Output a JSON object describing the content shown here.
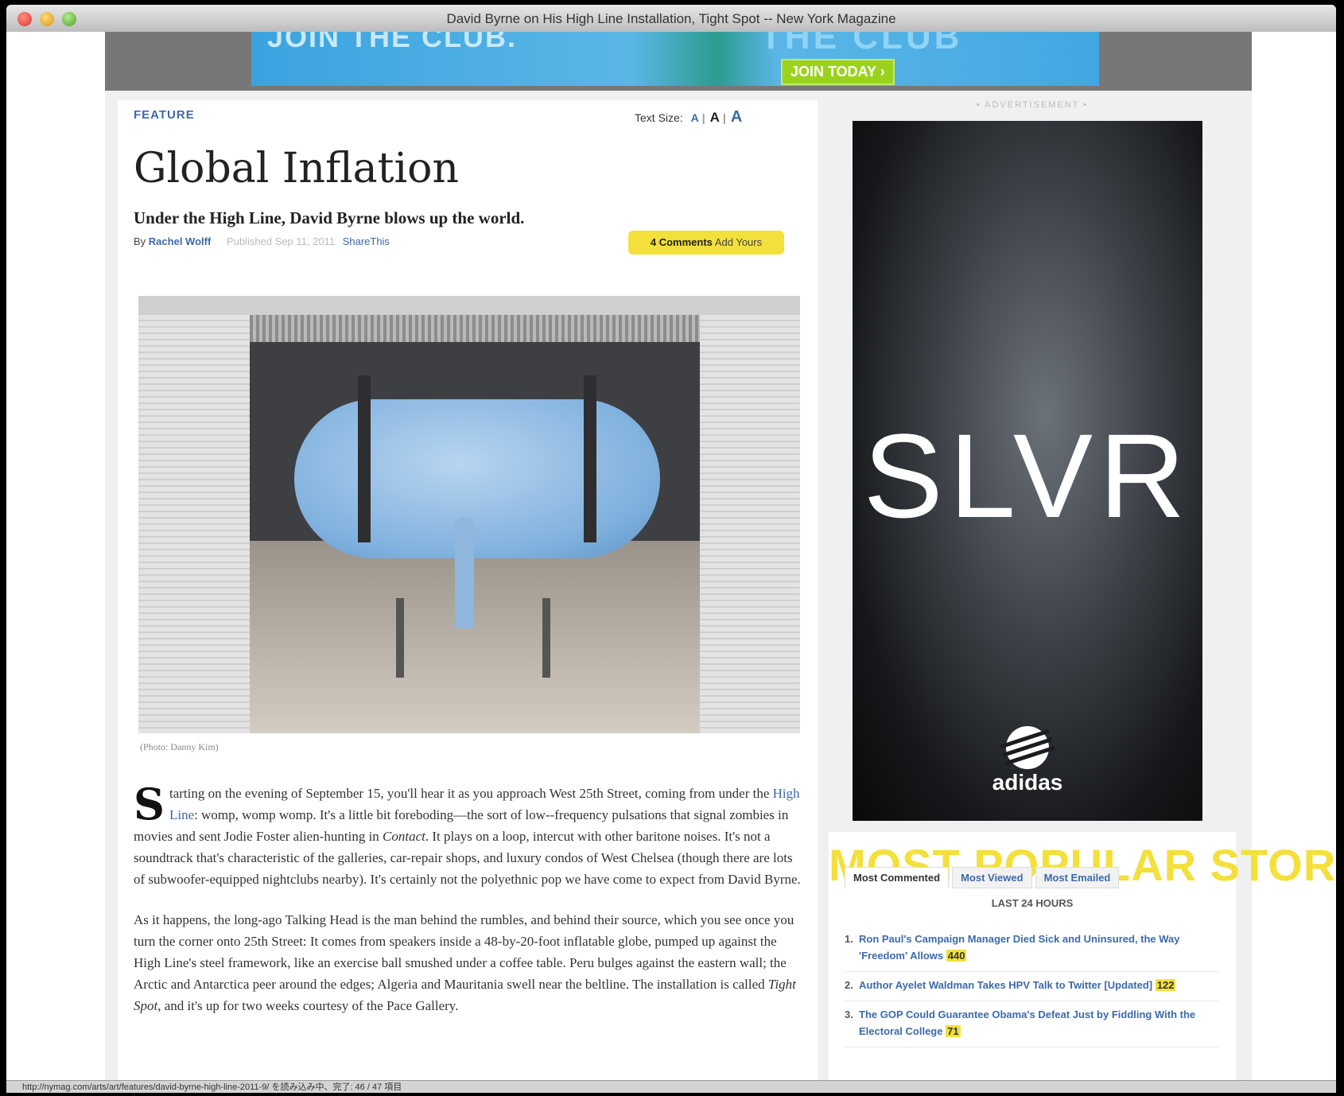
{
  "window": {
    "title": "David Byrne on His High Line Installation, Tight Spot -- New York Magazine"
  },
  "banner": {
    "left_text": "JOIN THE CLUB.",
    "right_text": "THE CLUB",
    "button": "JOIN TODAY ›"
  },
  "article": {
    "section": "FEATURE",
    "text_size_label": "Text Size:",
    "text_size_options": [
      "A",
      "A",
      "A"
    ],
    "headline": "Global Inflation",
    "dek": "Under the High Line, David Byrne blows up the world.",
    "by": "By",
    "author": "Rachel Wolff",
    "published": "Published Sep 11, 2011",
    "share": "ShareThis",
    "comments_count": "4 Comments",
    "comments_action": "Add Yours",
    "photo_caption": "(Photo: Danny Kim)",
    "dropcap": "S",
    "p1_a": "tarting on the evening of September 15, you'll hear it as you approach West 25th Street, coming from under the ",
    "p1_link": "High Line",
    "p1_b": ": womp, womp womp. It's a little bit foreboding—the sort of low--frequency pulsations that signal zombies in movies and sent Jodie Foster alien-hunting in ",
    "p1_italic": "Contact",
    "p1_c": ". It plays on a loop, intercut with other baritone noises. It's not a soundtrack that's characteristic of the galleries, car-repair shops, and luxury condos of West Chelsea (though there are lots of subwoofer-equipped nightclubs nearby). It's certainly not the polyethnic pop we have come to expect from David Byrne.",
    "p2_a": "As it happens, the long-ago Talking Head is the man behind the rumbles, and behind their source, which you see once you turn the corner onto 25th Street: It comes from speakers inside a 48-by-20-foot inflatable globe, pumped up against the High Line's steel framework, like an exercise ball smushed under a coffee table. Peru bulges against the eastern wall; the Arctic and Antarctica peer around the edges; Algeria and Mauritania swell near the beltline. The installation is called ",
    "p2_italic": "Tight Spot",
    "p2_b": ", and it's up for two weeks courtesy of the Pace Gallery."
  },
  "sidebar": {
    "ad_label": "• ADVERTISEMENT •",
    "ad_brand_text": "SLVR",
    "ad_logo_text": "adidas",
    "popular_title": "MOST POPULAR STORIES",
    "tabs": [
      "Most Commented",
      "Most Viewed",
      "Most Emailed"
    ],
    "period": "LAST 24 HOURS",
    "stories": [
      {
        "num": "1.",
        "title": "Ron Paul's Campaign Manager Died Sick and Uninsured, the Way 'Freedom' Allows",
        "count": "440"
      },
      {
        "num": "2.",
        "title": "Author Ayelet Waldman Takes HPV Talk to Twitter [Updated]",
        "count": "122"
      },
      {
        "num": "3.",
        "title": "The GOP Could Guarantee Obama's Defeat Just by Fiddling With the Electoral College",
        "count": "71"
      }
    ]
  },
  "status_bar": {
    "text": "http://nymag.com/arts/art/features/david-byrne-high-line-2011-9/ を読み込み中、完了: 46 / 47 項目"
  },
  "colors": {
    "link": "#3d6aa8",
    "highlight": "#f3e03b",
    "banner_button": "#9bd21c"
  }
}
